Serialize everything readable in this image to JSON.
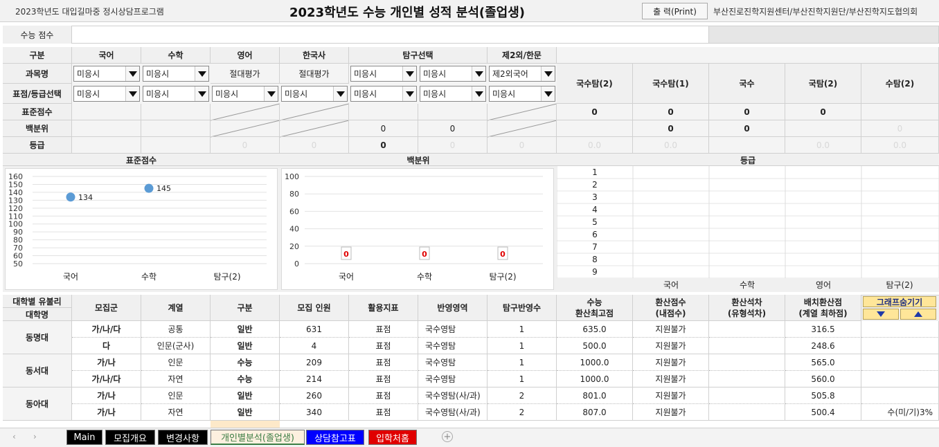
{
  "header": {
    "program": "2023학년도 대입길마중 정시상담프로그램",
    "title": "2023학년도 수능 개인별 성적 분석(졸업생)",
    "print": "출 력(Print)",
    "org": "부산진로진학지원센터/부산진학지원단/부산진학지도협의회"
  },
  "score_input": {
    "label": "수능 점수",
    "value": ""
  },
  "subjects": {
    "col_gubun": "구분",
    "korean": "국어",
    "math": "수학",
    "english": "영어",
    "history": "한국사",
    "inquiry": "탐구선택",
    "second": "제2외/한문",
    "row_subject": "과목명",
    "row_select": "표점/등급선택",
    "row_std": "표준점수",
    "row_pct": "백분위",
    "row_grade": "등급",
    "unselected": "미응시",
    "absolute": "절대평가",
    "second_value": "제2외국어",
    "zero": "0"
  },
  "combos": {
    "headers": [
      "국수탐(2)",
      "국수탐(1)",
      "국수",
      "국탐(2)",
      "수탐(2)"
    ],
    "std": [
      "0",
      "0",
      "0",
      "0",
      ""
    ],
    "pct": [
      "",
      "0",
      "0",
      "",
      "0"
    ],
    "grade": [
      "0.0",
      "0.0",
      "",
      "0.0",
      "0.0"
    ]
  },
  "chart_std": {
    "title": "표준점수",
    "type": "scatter",
    "categories": [
      "국어",
      "수학",
      "탐구(2)"
    ],
    "values": [
      134,
      145,
      null
    ],
    "yticks": [
      "160",
      "150",
      "140",
      "130",
      "120",
      "110",
      "100",
      "90",
      "80",
      "70",
      "60",
      "50"
    ],
    "labels": [
      "134",
      "145"
    ]
  },
  "chart_pct": {
    "title": "백분위",
    "type": "bar",
    "categories": [
      "국어",
      "수학",
      "탐구(2)"
    ],
    "values": [
      0,
      0,
      0
    ],
    "yticks": [
      "100",
      "80",
      "60",
      "40",
      "20",
      "0"
    ],
    "labels": [
      "0",
      "0",
      "0"
    ]
  },
  "chart_grade": {
    "title": "등급",
    "yticks": [
      "1",
      "2",
      "3",
      "4",
      "5",
      "6",
      "7",
      "8",
      "9"
    ],
    "categories": [
      "국어",
      "수학",
      "영어",
      "탐구(2)"
    ]
  },
  "table": {
    "h_univ_top": "대학별 유불리",
    "h_univ": "대학명",
    "h_group": "모집군",
    "h_track": "계열",
    "h_type": "구분",
    "h_quota": "모집 인원",
    "h_index": "활용지표",
    "h_area": "반영영역",
    "h_inq": "탐구반영수",
    "h_max_1": "수능",
    "h_max_2": "환산최고점",
    "h_conv_1": "환산점수",
    "h_conv_2": "(내점수)",
    "h_rank_1": "환산석차",
    "h_rank_2": "(유형석차)",
    "h_place_1": "배치환산점",
    "h_place_2": "(계열 최하점)",
    "graph_hide": "그래프숨기기",
    "rows": [
      {
        "univ": "동명대",
        "group": "가/나/다",
        "track": "공통",
        "type": "일반",
        "quota": "631",
        "index": "표점",
        "area": "국수영탐",
        "inq": "1",
        "max": "635.0",
        "conv": "지원불가",
        "rank": "",
        "place": "316.5",
        "note": ""
      },
      {
        "univ": "",
        "group": "다",
        "track": "인문(군사)",
        "type": "일반",
        "quota": "4",
        "index": "표점",
        "area": "국수영탐",
        "inq": "1",
        "max": "500.0",
        "conv": "지원불가",
        "rank": "",
        "place": "248.6",
        "note": ""
      },
      {
        "univ": "동서대",
        "group": "가/나",
        "track": "인문",
        "type": "수능",
        "quota": "209",
        "index": "표점",
        "area": "국수영탐",
        "inq": "1",
        "max": "1000.0",
        "conv": "지원불가",
        "rank": "",
        "place": "565.0",
        "note": ""
      },
      {
        "univ": "",
        "group": "가/나/다",
        "track": "자연",
        "type": "수능",
        "quota": "214",
        "index": "표점",
        "area": "국수영탐",
        "inq": "1",
        "max": "1000.0",
        "conv": "지원불가",
        "rank": "",
        "place": "560.0",
        "note": ""
      },
      {
        "univ": "동아대",
        "group": "가/나",
        "track": "인문",
        "type": "일반",
        "quota": "260",
        "index": "표점",
        "area": "국수영탐(사/과)",
        "inq": "2",
        "max": "801.0",
        "conv": "지원불가",
        "rank": "",
        "place": "505.8",
        "note": ""
      },
      {
        "univ": "",
        "group": "가/나",
        "track": "자연",
        "type": "일반",
        "quota": "340",
        "index": "표점",
        "area": "국수영탐(사/과)",
        "inq": "2",
        "max": "807.0",
        "conv": "지원불가",
        "rank": "",
        "place": "500.4",
        "note": "수(미/기)3%"
      }
    ]
  },
  "tabs": [
    {
      "label": "Main"
    },
    {
      "label": "모집개요"
    },
    {
      "label": "변경사항"
    },
    {
      "label": "개인별분석(졸업생)"
    },
    {
      "label": "상담참고표"
    },
    {
      "label": "입학처홈"
    }
  ]
}
